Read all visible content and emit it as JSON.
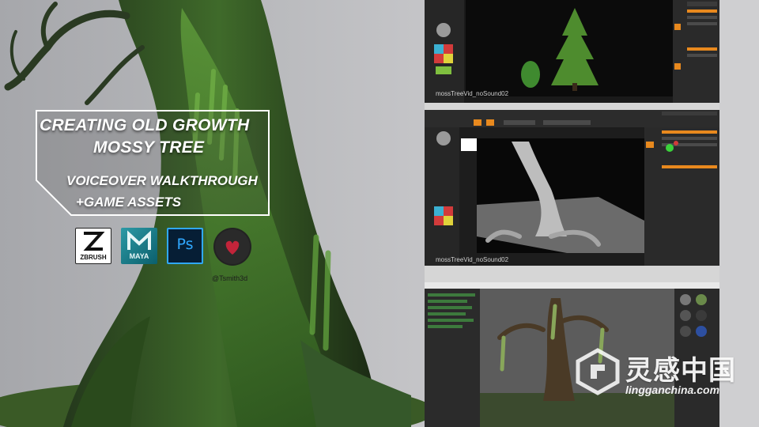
{
  "title": {
    "line1": "CREATING OLD GROWTH",
    "line2": "MOSSY TREE",
    "line3": "VOICEOVER WALKTHROUGH",
    "line4": "+GAME ASSETS"
  },
  "logos": {
    "zbrush": "ZBRUSH",
    "maya": "MAYA",
    "photoshop": "Ps",
    "author_handle": "@Tsmith3d"
  },
  "panels": {
    "panel1_caption": "mossTreeVid_noSound02",
    "panel2_caption": "mossTreeVid_noSound02"
  },
  "watermark": {
    "chinese": "灵感中国",
    "domain": "lingganchina.com"
  },
  "colors": {
    "moss_green": "#3f7a2a",
    "zbrush_orange": "#e8891e",
    "photoshop_blue": "#30a8ff"
  }
}
